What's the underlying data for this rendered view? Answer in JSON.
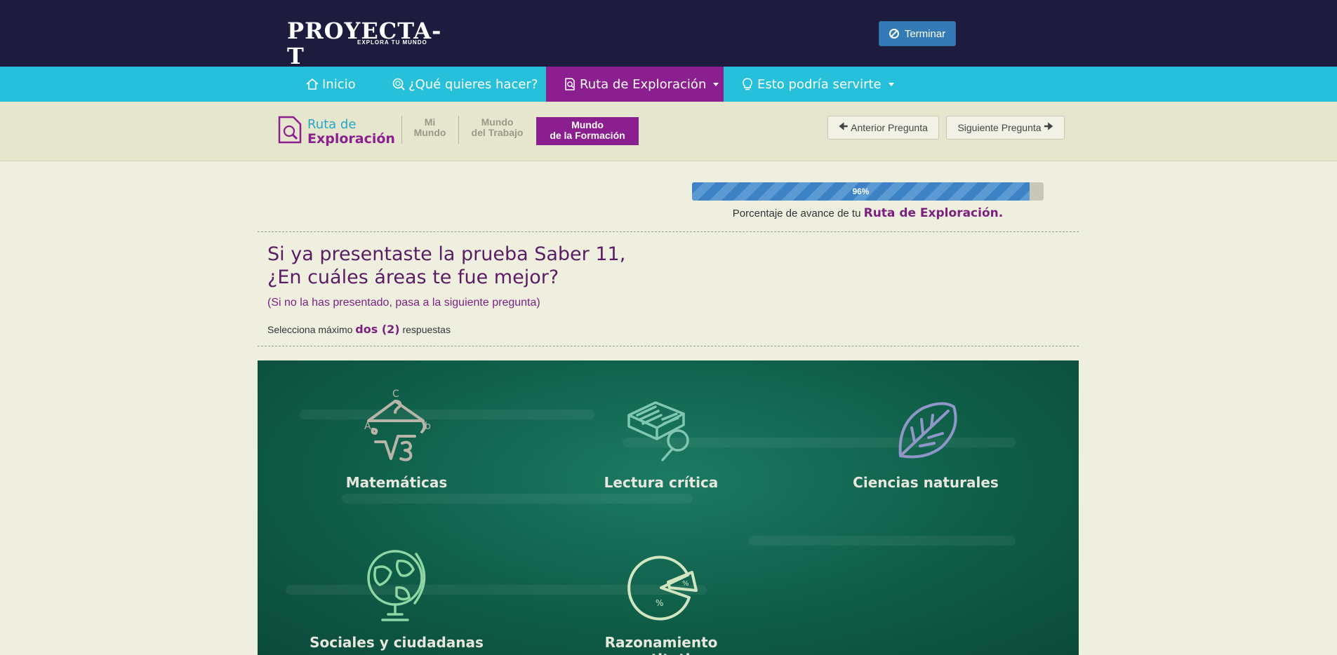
{
  "header": {
    "logo_text": "PROYECTA-T",
    "logo_tagline": "EXPLORA TU MUNDO",
    "finish_button": "Terminar"
  },
  "nav": {
    "items": [
      {
        "label": "Inicio",
        "icon": "home-icon"
      },
      {
        "label": "¿Qué quieres hacer?",
        "icon": "magnifier-icon"
      },
      {
        "label": "Ruta de Exploración",
        "icon": "document-search-icon",
        "active": true,
        "dropdown": true
      },
      {
        "label": "Esto podría servirte",
        "icon": "lightbulb-icon",
        "dropdown": true
      }
    ]
  },
  "route": {
    "title_line1": "Ruta de",
    "title_line2": "Exploración",
    "steps": [
      {
        "line1": "Mi",
        "line2": "Mundo"
      },
      {
        "line1": "Mundo",
        "line2": "del Trabajo"
      },
      {
        "line1": "Mundo",
        "line2": "de la Formación",
        "active": true
      }
    ],
    "prev_button": "Anterior Pregunta",
    "next_button": "Siguiente Pregunta"
  },
  "progress": {
    "value": 96,
    "label": "96%",
    "caption_prefix": "Porcentaje de avance de tu",
    "caption_emphasis": "Ruta de Exploración."
  },
  "question": {
    "title_line1": "Si ya presentaste la prueba Saber 11,",
    "title_line2": "¿En cuáles áreas te fue mejor?",
    "note": "(Si no la has presentado, pasa a la siguiente pregunta)",
    "instruction_prefix": "Selecciona máximo",
    "instruction_emphasis": "dos (2)",
    "instruction_suffix": "respuestas"
  },
  "options": [
    {
      "label": "Matemáticas",
      "icon": "math-triangle-icon"
    },
    {
      "label": "Lectura crítica",
      "icon": "book-magnifier-icon"
    },
    {
      "label": "Ciencias naturales",
      "icon": "leaf-icon"
    },
    {
      "label": "Sociales y ciudadanas",
      "icon": "globe-icon"
    },
    {
      "label": "Razonamiento cuantitativo",
      "icon": "pie-chart-icon"
    }
  ],
  "colors": {
    "topbar": "#1d1c3f",
    "nav": "#26c0da",
    "accent_purple": "#8b1f8f",
    "button_blue": "#337ab7",
    "board_green": "#0f5e48"
  }
}
